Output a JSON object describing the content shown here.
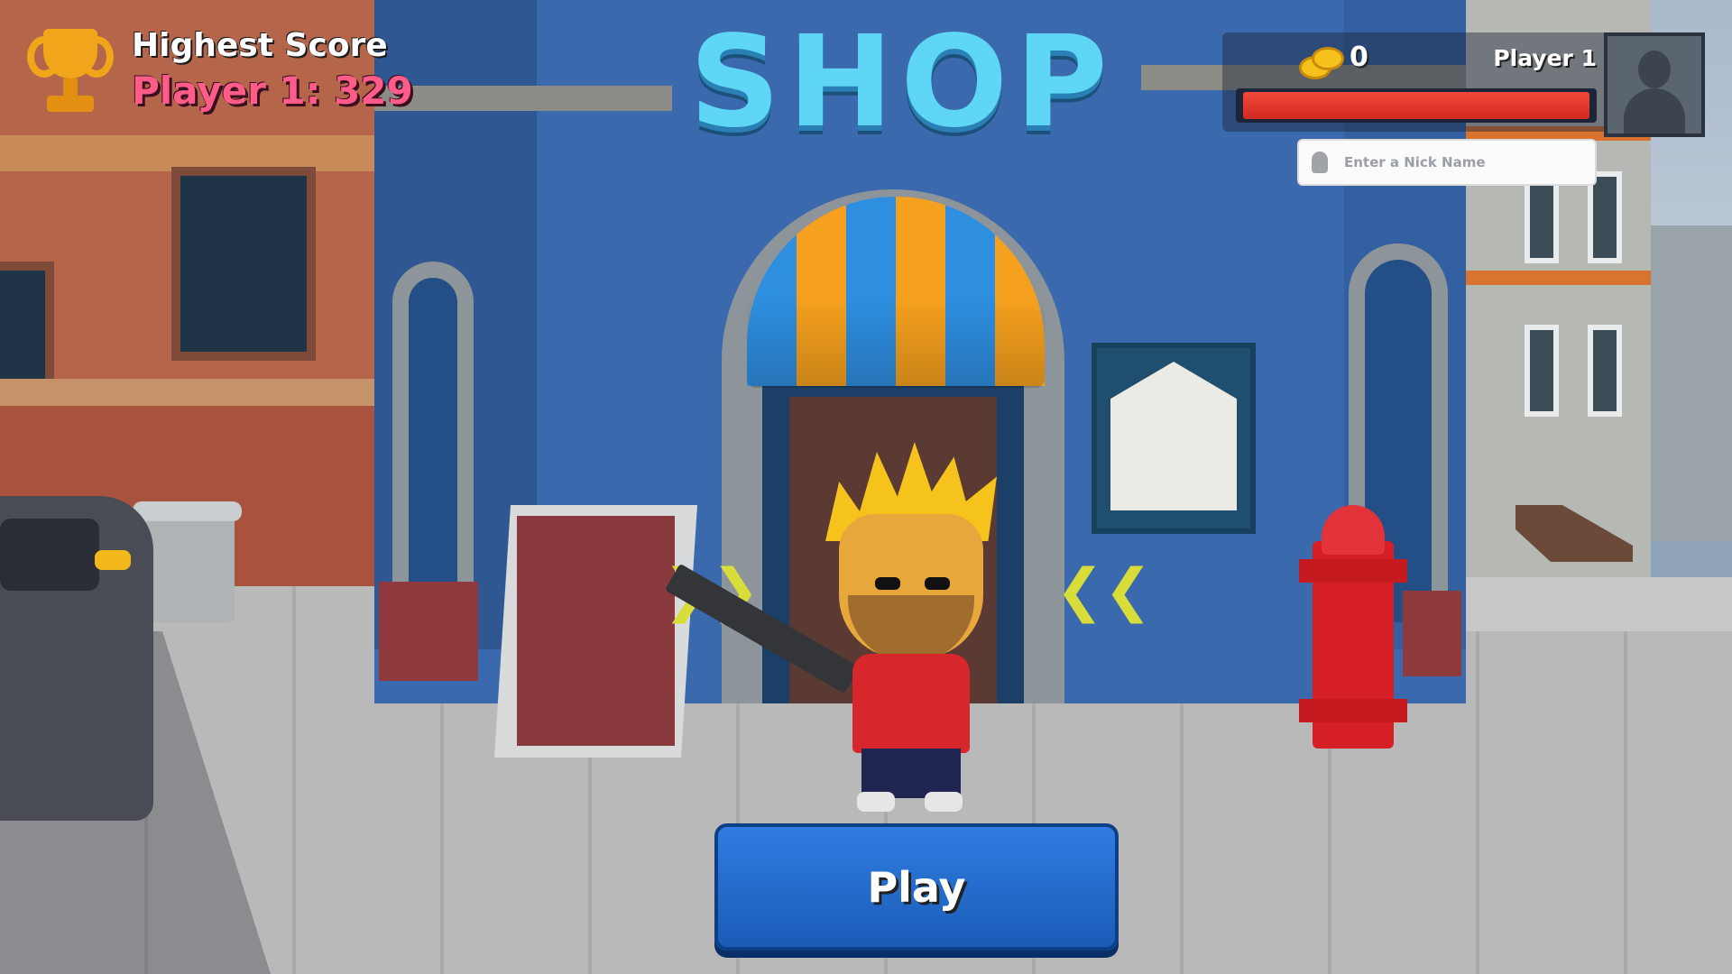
{
  "hud": {
    "highest_score_label": "Highest Score",
    "highest_score_value": "Player 1: 329",
    "shop_title": "SHOP",
    "coins": "0",
    "player_name": "Player 1",
    "health_fraction": 1.0,
    "nickname_placeholder": "Enter a Nick Name",
    "nickname_value": ""
  },
  "actions": {
    "play_label": "Play"
  },
  "icons": {
    "trophy": "trophy-icon",
    "coins": "coins-icon",
    "avatar": "avatar-icon",
    "nickname": "user-pin-icon",
    "arrows_left": "chevron-right-double-icon",
    "arrows_right": "chevron-left-double-icon"
  },
  "colors": {
    "score_pink": "#ff5c8a",
    "shop_title_cyan": "#5fd6f5",
    "health_red": "#e33a2c",
    "play_blue": "#2f7de0"
  }
}
